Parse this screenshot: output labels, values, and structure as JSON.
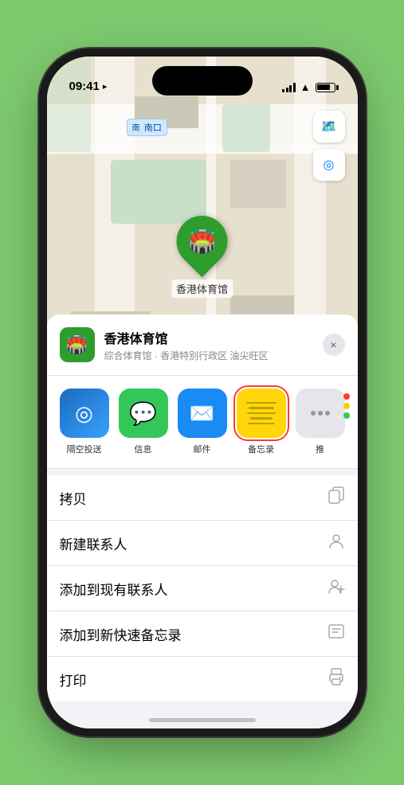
{
  "status": {
    "time": "09:41",
    "time_icon": "location-arrow-icon"
  },
  "map": {
    "label": "南口",
    "label_prefix": "南",
    "stadium_name": "香港体育馆",
    "pin_emoji": "🏟️"
  },
  "place_card": {
    "name": "香港体育馆",
    "subtitle": "综合体育馆 · 香港特别行政区 油尖旺区",
    "close_label": "×"
  },
  "share_apps": [
    {
      "id": "airdrop",
      "label": "隔空投送",
      "type": "airdrop"
    },
    {
      "id": "messages",
      "label": "信息",
      "type": "messages"
    },
    {
      "id": "mail",
      "label": "邮件",
      "type": "mail"
    },
    {
      "id": "notes",
      "label": "备忘录",
      "type": "notes",
      "selected": true
    },
    {
      "id": "more",
      "label": "推",
      "type": "more"
    }
  ],
  "actions": [
    {
      "id": "copy",
      "label": "拷贝",
      "icon": "📋"
    },
    {
      "id": "new-contact",
      "label": "新建联系人",
      "icon": "👤"
    },
    {
      "id": "add-existing",
      "label": "添加到现有联系人",
      "icon": "👤"
    },
    {
      "id": "add-notes",
      "label": "添加到新快速备忘录",
      "icon": "📝"
    },
    {
      "id": "print",
      "label": "打印",
      "icon": "🖨️"
    }
  ],
  "colors": {
    "green": "#2d9e2d",
    "blue": "#007aff",
    "red": "#ff3b30",
    "selected_border": "#ff3b30"
  }
}
